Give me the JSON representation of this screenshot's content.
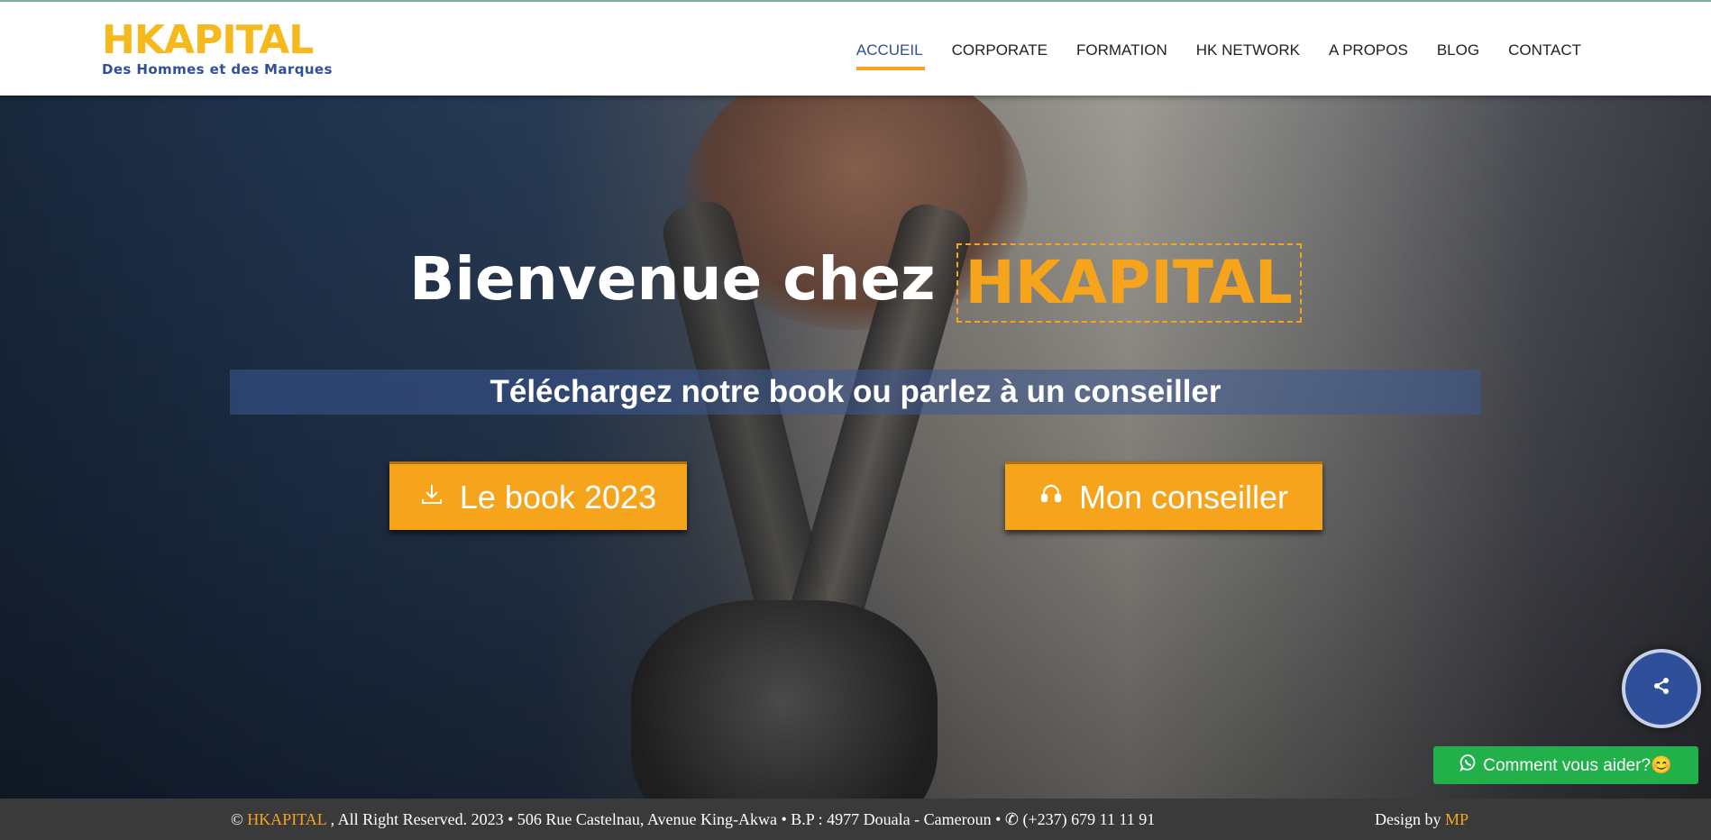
{
  "colors": {
    "brand_yellow": "#f5b91c",
    "accent_orange": "#f5a41c",
    "brand_blue": "#2f4f9a",
    "whatsapp_green": "#22b04a",
    "footer_bg": "#3a3a3a"
  },
  "logo": {
    "name": "HKAPITAL",
    "tagline": "Des Hommes et des Marques"
  },
  "nav": {
    "items": [
      {
        "label": "ACCUEIL",
        "active": true
      },
      {
        "label": "CORPORATE"
      },
      {
        "label": "FORMATION"
      },
      {
        "label": "HK NETWORK"
      },
      {
        "label": "A PROPOS"
      },
      {
        "label": "BLOG"
      },
      {
        "label": "CONTACT"
      }
    ]
  },
  "hero": {
    "welcome_text": "Bienvenue chez",
    "brand_text": "HKAPITAL",
    "subtitle": "Téléchargez notre book ou parlez à un conseiller",
    "book_button": {
      "label": "Le book 2023",
      "icon": "download-icon"
    },
    "advisor_button": {
      "label": "Mon conseiller",
      "icon": "headset-icon"
    }
  },
  "widgets": {
    "share_icon": "share-icon",
    "help_label": "Comment vous aider?😊",
    "help_icon": "whatsapp-icon"
  },
  "footer": {
    "copyright_symbol": "©",
    "brand": "HKAPITAL",
    "rights_text": ", All Right Reserved. 2023 • 506 Rue Castelnau, Avenue King-Akwa • B.P : 4977 Douala - Cameroun •",
    "phone": "(+237) 679 11 11 91",
    "design_by_label": "Design by",
    "designer": "MP"
  }
}
